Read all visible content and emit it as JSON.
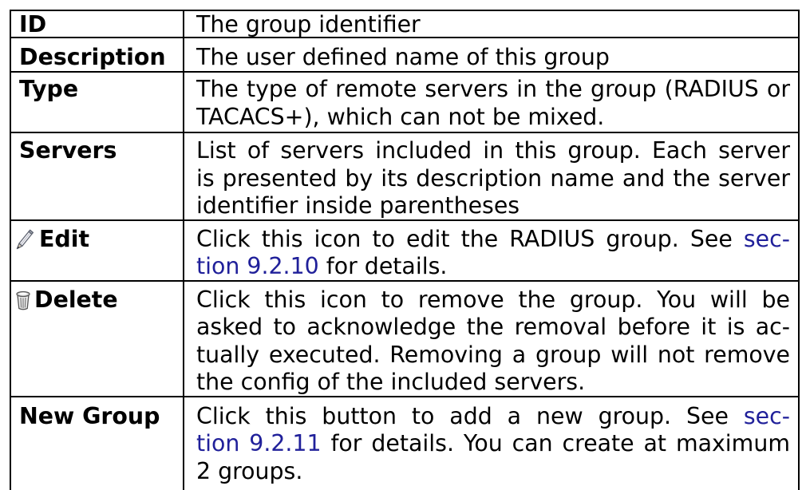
{
  "colors": {
    "text": "#000000",
    "border": "#000000",
    "link": "#20209a",
    "background": "#ffffff"
  },
  "rows": [
    {
      "label": "ID",
      "lines": [
        "The group identifier"
      ]
    },
    {
      "label": "Description",
      "lines": [
        "The user defined name of this group"
      ]
    },
    {
      "label": "Type",
      "lines": [
        "The type of remote servers in the group (RADIUS or",
        "TACACS+), which can not be mixed."
      ]
    },
    {
      "label": "Servers",
      "lines": [
        "List of servers included in this group. Each server",
        "is presented by its description name and the server",
        "identifier inside parentheses"
      ]
    },
    {
      "label": "Edit",
      "icon": "pencil-icon",
      "lines": [
        {
          "before": "Click this icon to edit the RADIUS group. See ",
          "link": "sec-"
        },
        {
          "link": "tion 9.2.10",
          "after": " for details."
        }
      ]
    },
    {
      "label": "Delete",
      "icon": "trash-icon",
      "lines": [
        "Click this icon to remove the group. You will be",
        "asked to acknowledge the removal before it is ac-",
        "tually executed. Removing a group will not remove",
        "the config of the included servers."
      ]
    },
    {
      "label": "New Group",
      "lines": [
        {
          "before": "Click this button to add a new group. See ",
          "link": "sec-"
        },
        {
          "link": "tion 9.2.11",
          "after": " for details. You can create at maximum"
        },
        "2 groups."
      ]
    }
  ]
}
